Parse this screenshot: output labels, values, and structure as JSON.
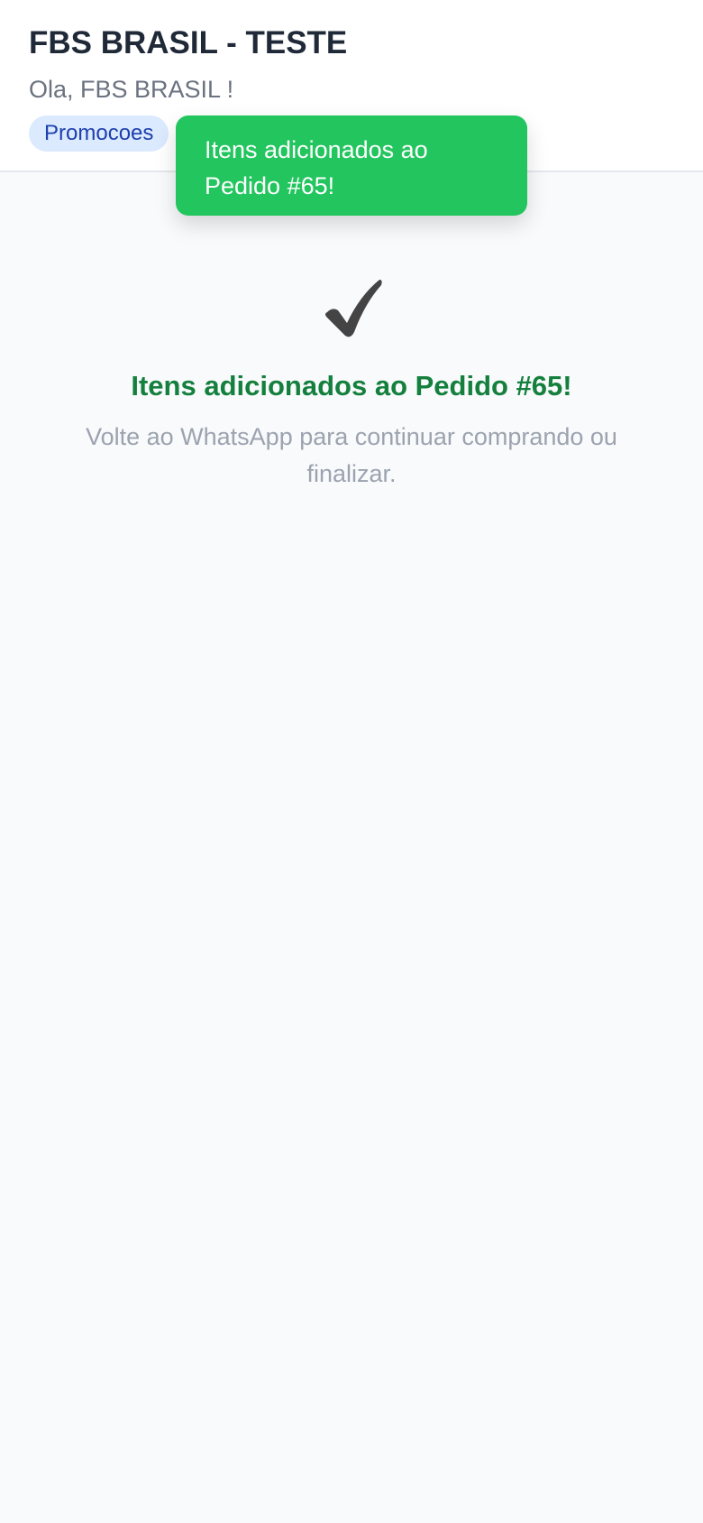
{
  "header": {
    "title": "FBS BRASIL - TESTE",
    "greeting": "Ola, FBS BRASIL !",
    "promo_label": "Promocoes"
  },
  "toast": {
    "message": "Itens adicionados ao Pedido #65!",
    "color": "#22c55e"
  },
  "main": {
    "icon": "checkmark-icon",
    "title": "Itens adicionados ao Pedido #65!",
    "subtitle": "Volte ao WhatsApp para continuar comprando ou finalizar."
  },
  "colors": {
    "success_title": "#15803d",
    "promo_bg": "#dbeafe",
    "promo_text": "#1e40af"
  }
}
